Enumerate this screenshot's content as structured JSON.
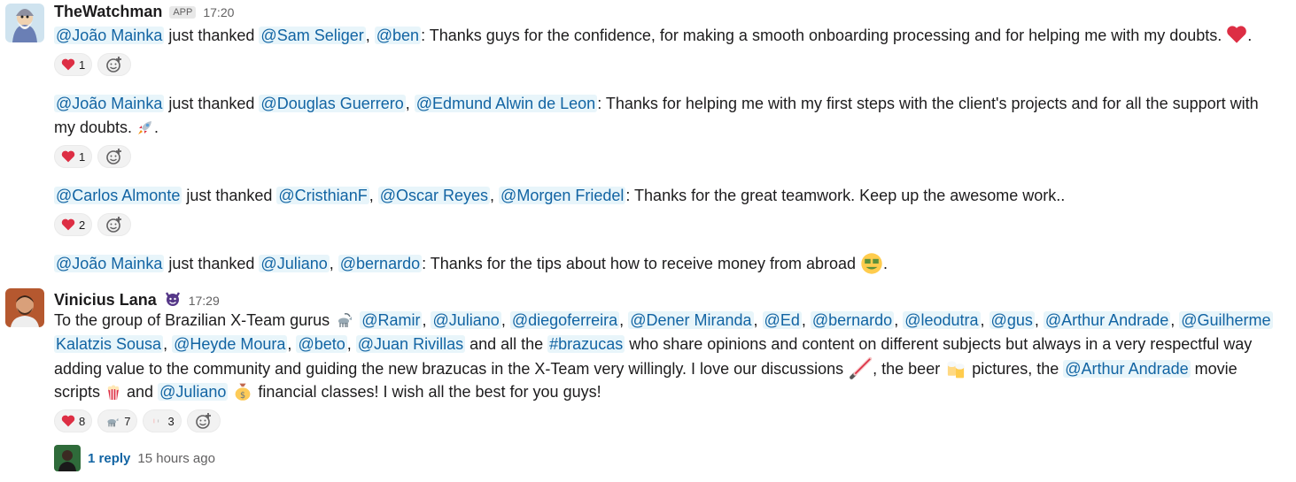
{
  "msg1": {
    "author": "TheWatchman",
    "badge": "APP",
    "time": "17:20",
    "p1": {
      "m1": "@João Mainka",
      "t1": " just thanked ",
      "m2": "@Sam Seliger",
      "sep1": ", ",
      "m3": "@ben",
      "t2": ": Thanks guys for the confidence, for making a smooth onboarding processing and for helping me with my doubts. ",
      "end": ".",
      "emoji": "heart-emoji",
      "reactions": [
        {
          "emoji": "heart-emoji",
          "count": "1"
        }
      ]
    },
    "p2": {
      "m1": "@João Mainka",
      "t1": " just thanked ",
      "m2": "@Douglas Guerrero",
      "sep1": ", ",
      "m3": "@Edmund Alwin de Leon",
      "t2": ": Thanks for helping me with my first steps with the client's projects and for all the support with",
      "t3": "my doubts. ",
      "end": ".",
      "emoji": "rocket-emoji",
      "reactions": [
        {
          "emoji": "heart-emoji",
          "count": "1"
        }
      ]
    },
    "p3": {
      "m1": "@Carlos Almonte",
      "t1": " just thanked ",
      "m2": "@CristhianF",
      "sep1": ", ",
      "m3": "@Oscar Reyes",
      "sep2": ", ",
      "m4": "@Morgen Friedel",
      "t2": ": Thanks for the great teamwork. Keep up the awesome work..",
      "reactions": [
        {
          "emoji": "heart-emoji",
          "count": "2"
        }
      ]
    },
    "p4": {
      "m1": "@João Mainka",
      "t1": " just thanked ",
      "m2": "@Juliano",
      "sep1": ", ",
      "m3": "@bernardo",
      "t2": ": Thanks for the tips about how to receive money from abroad ",
      "end": ".",
      "emoji": "money-mouth-face-emoji"
    }
  },
  "msg2": {
    "author": "Vinicius Lana",
    "author_emoji": "devil-emoji",
    "time": "17:29",
    "l1": {
      "t1": "To the group of Brazilian X-Team gurus ",
      "emoji": "goat-emoji",
      "m1": "@Ramir",
      "m2": "@Juliano",
      "m3": "@diegoferreira",
      "m4": "@Dener Miranda",
      "m5": "@Ed",
      "m6": "@bernardo",
      "m7": "@leodutra",
      "m8": "@gus",
      "m9": "@Arthur Andrade",
      "m10": "@Guilherme",
      "sep": ", "
    },
    "l2": {
      "m1": "Kalatzis Sousa",
      "m2": "@Heyde Moura",
      "m3": "@beto",
      "m4": "@Juan Rivillas",
      "t1": " and all the ",
      "channel": "#brazucas",
      "t2": " who share opinions and content on different subjects but always in a very respectful way",
      "sep": ", "
    },
    "l3": {
      "t1": "adding value to the community and guiding the new brazucas in the X-Team very willingly. I love our discussions ",
      "emoji1": "lightsaber-emoji",
      "t2": ", the beer ",
      "emoji2": "beers-emoji",
      "t3": " pictures, the ",
      "m1": "@Arthur Andrade",
      "t4": " movie"
    },
    "l4": {
      "t1": "scripts ",
      "emoji1": "popcorn-emoji",
      "t2": " and ",
      "m1": "@Juliano",
      "emoji2": "money-bag-emoji",
      "t3": " financial classes! I wish all the best for you guys!"
    },
    "reactions": [
      {
        "emoji": "heart-emoji",
        "count": "8"
      },
      {
        "emoji": "goat-emoji",
        "count": "7"
      },
      {
        "emoji": "sparkle-emoji",
        "count": "3"
      }
    ],
    "thread": {
      "replies": "1 reply",
      "time": "15 hours ago"
    }
  },
  "colors": {
    "mention": "#1264a3",
    "mention_bg": "#e8f5fa",
    "heart": "#dd2e44",
    "muted": "#616061"
  }
}
